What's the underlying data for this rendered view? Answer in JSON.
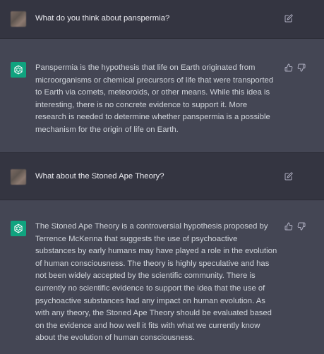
{
  "conversation": [
    {
      "role": "user",
      "text": "What do you think about panspermia?"
    },
    {
      "role": "assistant",
      "text": "Panspermia is the hypothesis that life on Earth originated from microorganisms or chemical precursors of life that were transported to Earth via comets, meteoroids, or other means. While this idea is interesting, there is no concrete evidence to support it. More research is needed to determine whether panspermia is a possible mechanism for the origin of life on Earth."
    },
    {
      "role": "user",
      "text": "What about the Stoned Ape Theory?"
    },
    {
      "role": "assistant",
      "text": "The Stoned Ape Theory is a controversial hypothesis proposed by Terrence McKenna that suggests the use of psychoactive substances by early humans may have played a role in the evolution of human consciousness. The theory is highly speculative and has not been widely accepted by the scientific community. There is currently no scientific evidence to support the idea that the use of psychoactive substances had any impact on human evolution. As with any theory, the Stoned Ape Theory should be evaluated based on the evidence and how well it fits with what we currently know about the evolution of human consciousness."
    }
  ],
  "icons": {
    "edit": "edit-icon",
    "thumbs_up": "thumbs-up-icon",
    "thumbs_down": "thumbs-down-icon",
    "assistant_logo": "openai-logo-icon"
  },
  "colors": {
    "user_row_bg": "#343541",
    "assistant_row_bg": "#444654",
    "assistant_avatar": "#10a37f",
    "text": "#ececf1",
    "icon": "#acacbe"
  }
}
